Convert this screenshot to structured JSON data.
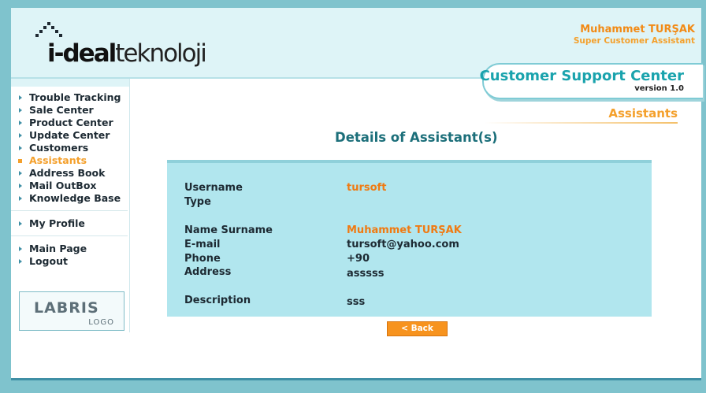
{
  "header": {
    "logo_text_bold": "i-deal",
    "logo_text_light": "teknoloji",
    "user_name": "Muhammet TURŞAK",
    "user_role": "Super Customer Assistant",
    "app_title": "Customer Support Center",
    "app_version": "version 1.0"
  },
  "sidebar": {
    "group1": [
      {
        "label": "Trouble Tracking",
        "active": false
      },
      {
        "label": "Sale Center",
        "active": false
      },
      {
        "label": "Product Center",
        "active": false
      },
      {
        "label": "Update Center",
        "active": false
      },
      {
        "label": "Customers",
        "active": false
      },
      {
        "label": "Assistants",
        "active": true
      },
      {
        "label": "Address Book",
        "active": false
      },
      {
        "label": "Mail OutBox",
        "active": false
      },
      {
        "label": "Knowledge Base",
        "active": false
      }
    ],
    "group2": [
      {
        "label": "My Profile",
        "active": false
      }
    ],
    "group3": [
      {
        "label": "Main Page",
        "active": false
      },
      {
        "label": "Logout",
        "active": false
      }
    ],
    "partner_logo_main": "LABRIS",
    "partner_logo_sub": "LOGO"
  },
  "main": {
    "section_title": "Assistants",
    "page_title": "Details of Assistant(s)",
    "fields": {
      "username_label": "Username",
      "username_value": "tursoft",
      "type_label": "Type",
      "type_value": "",
      "name_label": "Name Surname",
      "name_value": "Muhammet TURŞAK",
      "email_label": "E-mail",
      "email_value": "tursoft@yahoo.com",
      "phone_label": "Phone",
      "phone_value": "+90",
      "address_label": "Address",
      "address_value": "asssss",
      "description_label": "Description",
      "description_value": "sss"
    },
    "back_button": "< Back"
  },
  "colors": {
    "accent_orange": "#f4a02c",
    "accent_teal": "#1aa3ad",
    "panel_bg": "#b1e6ee",
    "outer_bg": "#7fc3cd"
  }
}
